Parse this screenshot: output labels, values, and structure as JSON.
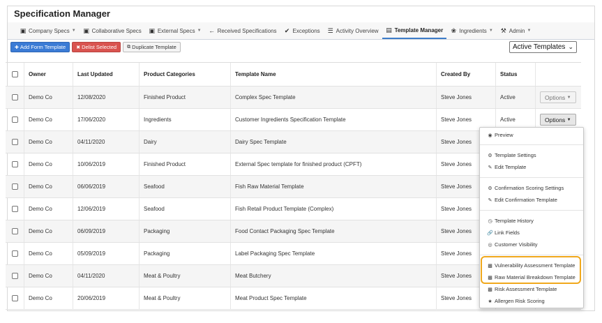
{
  "app": {
    "title": "Specification Manager"
  },
  "nav": [
    {
      "label": "Company Specs",
      "icon": "briefcase-icon",
      "dropdown": true
    },
    {
      "label": "Collaborative Specs",
      "icon": "briefcase-icon",
      "dropdown": false
    },
    {
      "label": "External Specs",
      "icon": "briefcase-icon",
      "dropdown": true
    },
    {
      "label": "Received Specifications",
      "icon": "arrow-left-icon",
      "dropdown": false
    },
    {
      "label": "Exceptions",
      "icon": "check-circle-icon",
      "dropdown": false
    },
    {
      "label": "Activity Overview",
      "icon": "list-icon",
      "dropdown": false
    },
    {
      "label": "Template Manager",
      "icon": "document-icon",
      "dropdown": false,
      "active": true
    },
    {
      "label": "Ingredients",
      "icon": "leaf-icon",
      "dropdown": true
    },
    {
      "label": "Admin",
      "icon": "wrench-icon",
      "dropdown": true
    }
  ],
  "toolbar": {
    "add": "Add Form Template",
    "delist": "Delist Selected",
    "duplicate": "Duplicate Template"
  },
  "filter": {
    "selected": "Active Templates"
  },
  "table": {
    "headers": [
      "Owner",
      "Last Updated",
      "Product Categories",
      "Template Name",
      "Created By",
      "Status"
    ],
    "rows": [
      {
        "owner": "Demo Co",
        "updated": "12/08/2020",
        "category": "Finished Product",
        "name": "Complex Spec Template",
        "created": "Steve Jones",
        "status": "Active",
        "options": "Options"
      },
      {
        "owner": "Demo Co",
        "updated": "17/06/2020",
        "category": "Ingredients",
        "name": "Customer Ingredients Specification Template",
        "created": "Steve Jones",
        "status": "Active",
        "options": "Options"
      },
      {
        "owner": "Demo Co",
        "updated": "04/11/2020",
        "category": "Dairy",
        "name": "Dairy Spec Template",
        "created": "Steve Jones"
      },
      {
        "owner": "Demo Co",
        "updated": "10/06/2019",
        "category": "Finished Product",
        "name": "External Spec template for finished product (CPFT)",
        "created": "Steve Jones"
      },
      {
        "owner": "Demo Co",
        "updated": "06/06/2019",
        "category": "Seafood",
        "name": "Fish Raw Material Template",
        "created": "Steve Jones"
      },
      {
        "owner": "Demo Co",
        "updated": "12/06/2019",
        "category": "Seafood",
        "name": "Fish Retail Product Template (Complex)",
        "created": "Steve Jones"
      },
      {
        "owner": "Demo Co",
        "updated": "06/09/2019",
        "category": "Packaging",
        "name": "Food Contact Packaging Spec Template",
        "created": "Steve Jones"
      },
      {
        "owner": "Demo Co",
        "updated": "05/09/2019",
        "category": "Packaging",
        "name": "Label Packaging Spec Template",
        "created": "Steve Jones"
      },
      {
        "owner": "Demo Co",
        "updated": "04/11/2020",
        "category": "Meat & Poultry",
        "name": "Meat Butchery",
        "created": "Steve Jones"
      },
      {
        "owner": "Demo Co",
        "updated": "20/06/2019",
        "category": "Meat & Poultry",
        "name": "Meat Product Spec Template",
        "created": "Steve Jones"
      }
    ]
  },
  "menu": {
    "preview": "Preview",
    "template_settings": "Template Settings",
    "edit_template": "Edit Template",
    "confirmation_scoring": "Confirmation Scoring Settings",
    "edit_confirmation": "Edit Confirmation Template",
    "history": "Template History",
    "link_fields": "Link Fields",
    "customer_visibility": "Customer Visibility",
    "vulnerability": "Vulnerability Assessment Template",
    "raw_material": "Raw Material Breakdown Template",
    "risk": "Risk Assessment Template",
    "allergen": "Allergen Risk Scoring"
  },
  "colors": {
    "accent": "#3d7cc9",
    "danger": "#d9534f",
    "highlight": "#f0a81c"
  }
}
